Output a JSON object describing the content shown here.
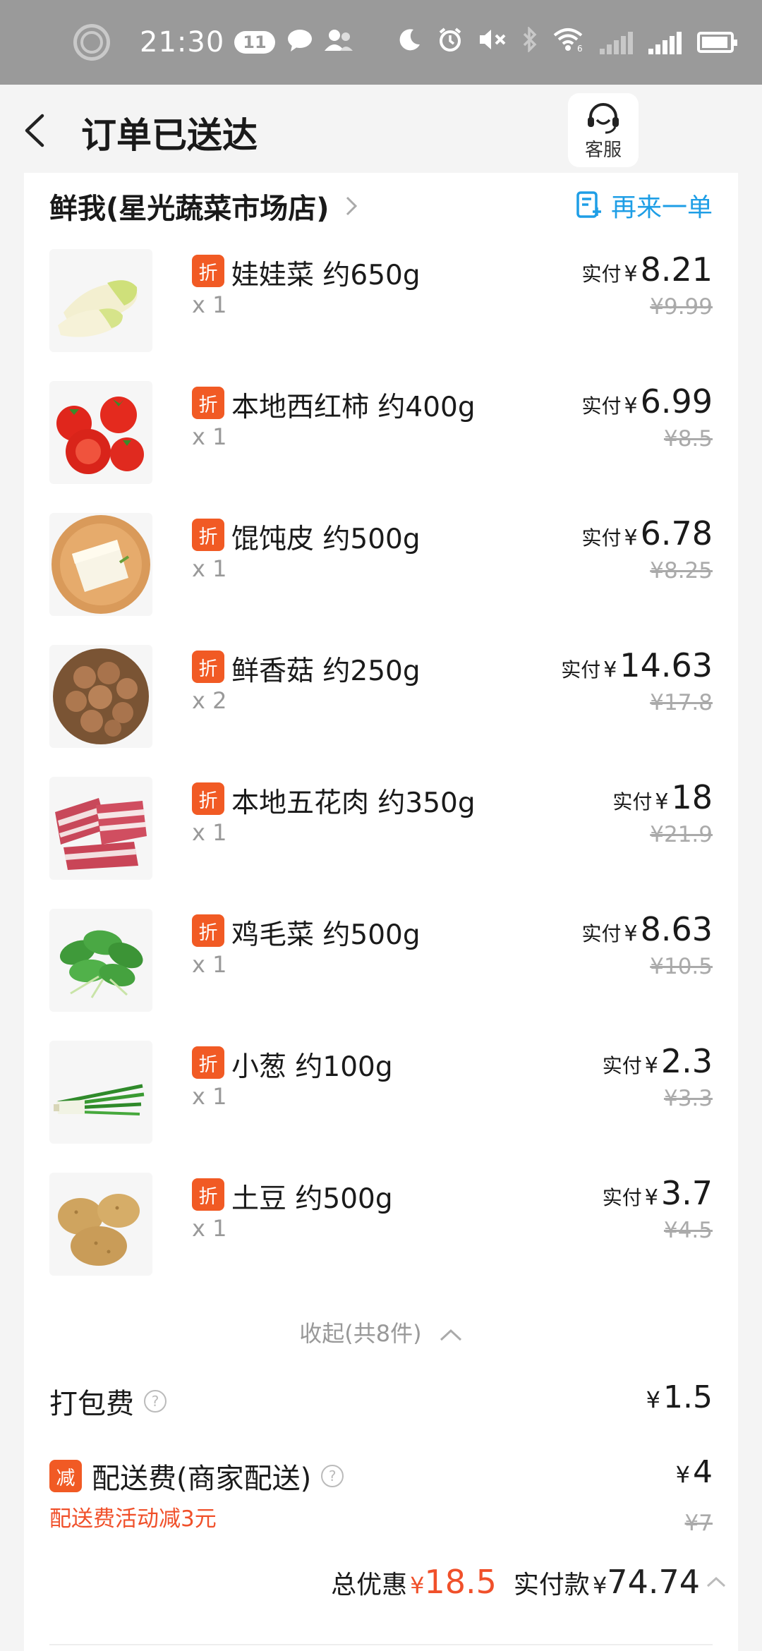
{
  "status_bar": {
    "time": "21:30",
    "notification_count": "11",
    "wifi_label": "6",
    "signal_label": "2"
  },
  "header": {
    "title": "订单已送达",
    "customer_service_label": "客服"
  },
  "store": {
    "name": "鲜我(星光蔬菜市场店)",
    "reorder_label": "再来一单"
  },
  "item_labels": {
    "discount_tag": "折",
    "paid_prefix": "实付",
    "currency": "¥"
  },
  "items": [
    {
      "name": "娃娃菜 约650g",
      "qty": "x 1",
      "paid": "8.21",
      "original": "¥9.99"
    },
    {
      "name": "本地西红柿 约400g",
      "qty": "x 1",
      "paid": "6.99",
      "original": "¥8.5"
    },
    {
      "name": "馄饨皮 约500g",
      "qty": "x 1",
      "paid": "6.78",
      "original": "¥8.25"
    },
    {
      "name": "鲜香菇 约250g",
      "qty": "x 2",
      "paid": "14.63",
      "original": "¥17.8"
    },
    {
      "name": "本地五花肉 约350g",
      "qty": "x 1",
      "paid": "18",
      "original": "¥21.9"
    },
    {
      "name": "鸡毛菜 约500g",
      "qty": "x 1",
      "paid": "8.63",
      "original": "¥10.5"
    },
    {
      "name": "小葱 约100g",
      "qty": "x 1",
      "paid": "2.3",
      "original": "¥3.3"
    },
    {
      "name": "土豆 约500g",
      "qty": "x 1",
      "paid": "3.7",
      "original": "¥4.5"
    }
  ],
  "collapse_label": "收起(共8件)",
  "fees": {
    "packing_label": "打包费",
    "packing_value": "1.5",
    "delivery_tag": "减",
    "delivery_label": "配送费(商家配送)",
    "delivery_value": "4",
    "delivery_original": "¥7",
    "delivery_promo": "配送费活动减3元",
    "help_mark": "?"
  },
  "totals": {
    "discount_label": "总优惠",
    "discount_value": "18.5",
    "paid_label": "实付款",
    "paid_value": "74.74"
  },
  "colors": {
    "accent_blue": "#1e9ee6",
    "discount_orange": "#f15a24",
    "price_red": "#f0502a"
  }
}
